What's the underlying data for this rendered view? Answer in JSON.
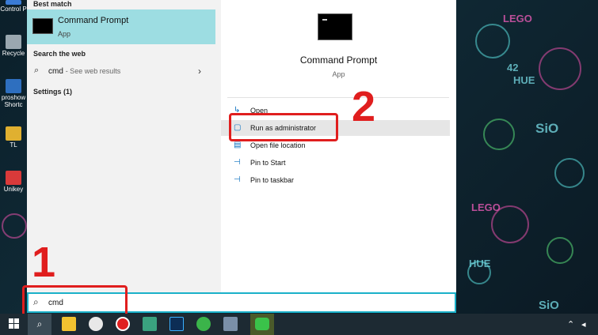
{
  "desktop": {
    "icons": [
      {
        "label": "Control P",
        "color": "#3a7bd5"
      },
      {
        "label": "Recycle",
        "color": "#9aa7b0"
      },
      {
        "label": "proshow Shortc",
        "color": "#2e6fbf"
      },
      {
        "label": "TL",
        "color": "#e0b030"
      },
      {
        "label": "Unikey",
        "color": "#d93a3a"
      }
    ],
    "wallpaper_texts": [
      "LEGO",
      "42",
      "HUE",
      "SiO",
      "LEGO",
      "HUE",
      "SiO"
    ]
  },
  "start_menu": {
    "best_match_label": "Best match",
    "best_match": {
      "title": "Command Prompt",
      "subtitle": "App"
    },
    "search_web_label": "Search the web",
    "web_query": "cmd",
    "web_hint": "- See web results",
    "settings_label": "Settings (1)",
    "detail": {
      "title": "Command Prompt",
      "subtitle": "App"
    },
    "actions": [
      {
        "label": "Open",
        "icon": "open-icon"
      },
      {
        "label": "Run as administrator",
        "icon": "shield-icon"
      },
      {
        "label": "Open file location",
        "icon": "folder-icon"
      },
      {
        "label": "Pin to Start",
        "icon": "pin-icon"
      },
      {
        "label": "Pin to taskbar",
        "icon": "pin-icon"
      }
    ]
  },
  "search": {
    "value": "cmd"
  },
  "annotations": {
    "step1": "1",
    "step2": "2",
    "color": "#e01e1e"
  },
  "taskbar": {
    "apps": [
      {
        "name": "file-explorer-icon",
        "color": "#f2c230"
      },
      {
        "name": "game-icon",
        "color": "#e8e8e8"
      },
      {
        "name": "record-icon",
        "color": "#e02020"
      },
      {
        "name": "app-icon",
        "color": "#3aa27f"
      },
      {
        "name": "photoshop-icon",
        "color": "#0c2d55"
      },
      {
        "name": "chrome-icon",
        "color": "#3bb44a"
      },
      {
        "name": "network-app-icon",
        "color": "#7a8fa8"
      },
      {
        "name": "line-icon",
        "color": "#3ac24a"
      }
    ],
    "accent": "#1ab1c9"
  }
}
